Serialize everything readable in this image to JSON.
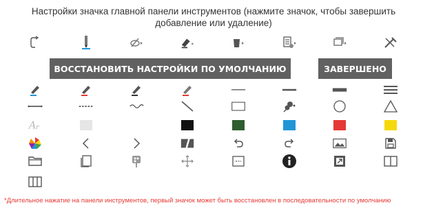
{
  "header": {
    "title": "Настройки значка главной панели инструментов (нажмите значок, чтобы завершить добавление или удаление)"
  },
  "toolbar_icons": [
    "redo-outline-icon",
    "pen-holder-icon",
    "eraser-arrow-icon",
    "highlighter-arrow-icon",
    "bucket-arrow-icon",
    "page-arrow-icon",
    "layers-arrow-icon",
    "tools-icon"
  ],
  "buttons": {
    "reset_label": "ВОССТАНОВИТЬ НАСТРОЙКИ ПО УМОЛЧАНИЮ",
    "done_label": "ЗАВЕРШЕНО"
  },
  "available_icons": [
    [
      "pen-blue-icon",
      "pen-red-icon",
      "pen-dark-icon",
      "pen-gray-icon",
      "thin-line-icon",
      "medium-line-icon",
      "thick-line-icon",
      "menu-lines-icon"
    ],
    [
      "solid-stroke-icon",
      "dashed-stroke-icon",
      "wave-icon",
      "diagonal-line-icon",
      "rectangle-icon",
      "shape-fill-icon",
      "circle-icon",
      "triangle-icon"
    ],
    [
      "text-style-icon",
      "light-gray-swatch",
      "white-swatch",
      "black-swatch",
      "dark-green-swatch",
      "blue-swatch",
      "red-swatch",
      "yellow-swatch"
    ],
    [
      "color-wheel-icon",
      "chevron-left-icon",
      "chevron-right-icon",
      "image-edit-icon",
      "undo-icon",
      "redo-icon",
      "image-icon",
      "save-icon"
    ],
    [
      "folder-icon",
      "copy-pages-icon",
      "palette-icon",
      "move-icon",
      "text-box-icon",
      "info-icon",
      "export-icon",
      "two-columns-icon"
    ],
    [
      "three-columns-icon"
    ]
  ],
  "colors": {
    "light_gray": "#e6e6e6",
    "white": "#ffffff",
    "black": "#111111",
    "dark_green": "#2e5e2e",
    "blue": "#2196d6",
    "red": "#e53935",
    "yellow": "#f5d90a",
    "button_bg": "#616161",
    "footnote_red": "#e53935"
  },
  "footnote": "*Длительное нажатие на панели инструментов, первый значок может быть восстановлен в последовательности по умолчанию"
}
